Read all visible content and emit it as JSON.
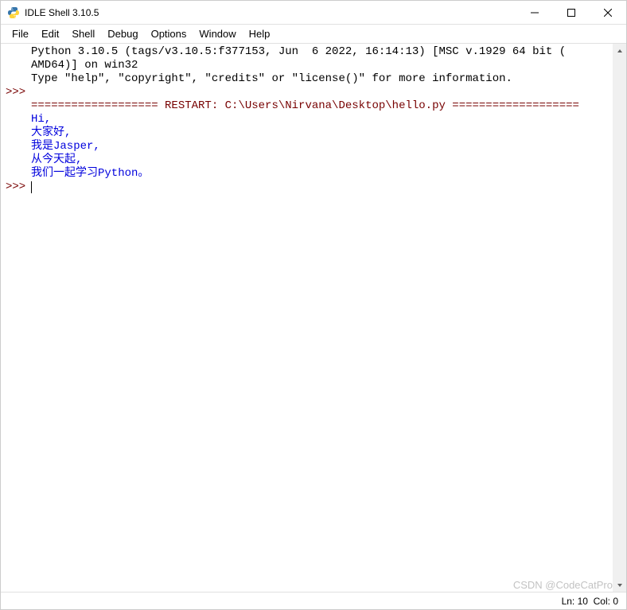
{
  "title": "IDLE Shell 3.10.5",
  "menubar": {
    "items": [
      "File",
      "Edit",
      "Shell",
      "Debug",
      "Options",
      "Window",
      "Help"
    ]
  },
  "prompt": ">>>",
  "header": {
    "line1": "Python 3.10.5 (tags/v3.10.5:f377153, Jun  6 2022, 16:14:13) [MSC v.1929 64 bit (",
    "line2": "AMD64)] on win32",
    "line3": "Type \"help\", \"copyright\", \"credits\" or \"license()\" for more information."
  },
  "restart_line": "=================== RESTART: C:\\Users\\Nirvana\\Desktop\\hello.py ===================",
  "output": {
    "l1": "Hi,",
    "l2": "大家好,",
    "l3": "我是Jasper,",
    "l4": "从今天起,",
    "l5": "我们一起学习Python。"
  },
  "status": {
    "ln_label": "Ln:",
    "ln_value": "10",
    "col_label": "Col:",
    "col_value": "0"
  },
  "watermark": "CSDN @CodeCatPro"
}
